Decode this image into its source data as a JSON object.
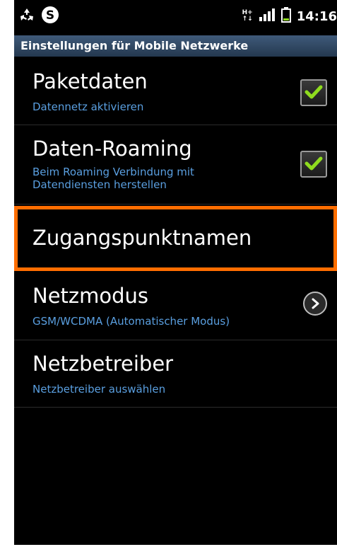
{
  "status": {
    "time": "14:16",
    "network": "H+"
  },
  "header": {
    "title": "Einstellungen für Mobile Netzwerke"
  },
  "items": [
    {
      "title": "Paketdaten",
      "subtitle": "Datennetz aktivieren",
      "checked": true
    },
    {
      "title": "Daten-Roaming",
      "subtitle_lines": [
        "Beim Roaming Verbindung mit",
        "Datendiensten herstellen"
      ],
      "checked": true
    },
    {
      "title": "Zugangspunktnamen",
      "highlighted": true
    },
    {
      "title": "Netzmodus",
      "subtitle": "GSM/WCDMA (Automatischer Modus)"
    },
    {
      "title": "Netzbetreiber",
      "subtitle": "Netzbetreiber auswählen"
    }
  ],
  "colors": {
    "highlight": "#ff6d00",
    "subtitle": "#5a9fe0",
    "check": "#8fdc1e"
  }
}
